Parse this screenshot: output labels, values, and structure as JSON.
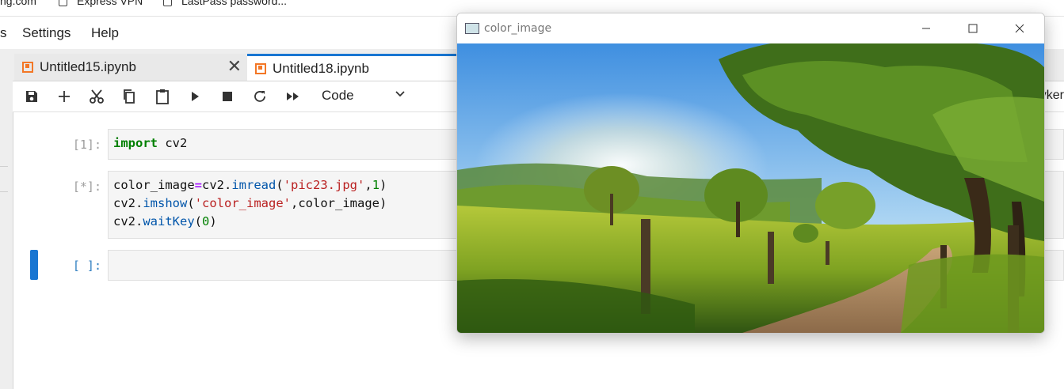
{
  "bookmarks": {
    "items": [
      {
        "label": "ng.com"
      },
      {
        "label": "Express VPN"
      },
      {
        "label": "LastPass password..."
      }
    ]
  },
  "menubar": {
    "items": [
      {
        "label": "s"
      },
      {
        "label": "Settings"
      },
      {
        "label": "Help"
      }
    ]
  },
  "tabs": [
    {
      "label": "Untitled15.ipynb",
      "active": false
    },
    {
      "label": "Untitled18.ipynb",
      "active": true
    }
  ],
  "toolbar": {
    "icons": [
      "save-icon",
      "add-icon",
      "cut-icon",
      "copy-icon",
      "paste-icon",
      "run-icon",
      "stop-icon",
      "restart-icon",
      "fast-forward-icon"
    ],
    "cell_type": "Code",
    "kernel_partial": "yker"
  },
  "cells": [
    {
      "prompt": "[1]:",
      "lines": [
        "import cv2"
      ]
    },
    {
      "prompt": "[*]:",
      "lines": [
        "color_image=cv2.imread('pic23.jpg',1)",
        "cv2.imshow('color_image',color_image)",
        "cv2.waitKey(0)"
      ]
    },
    {
      "prompt": "[ ]:",
      "lines": [
        ""
      ]
    }
  ],
  "image_window": {
    "title": "color_image",
    "content": "landscape-photo"
  },
  "colors": {
    "accent": "#1976d2",
    "jupyter_orange": "#f37726"
  }
}
